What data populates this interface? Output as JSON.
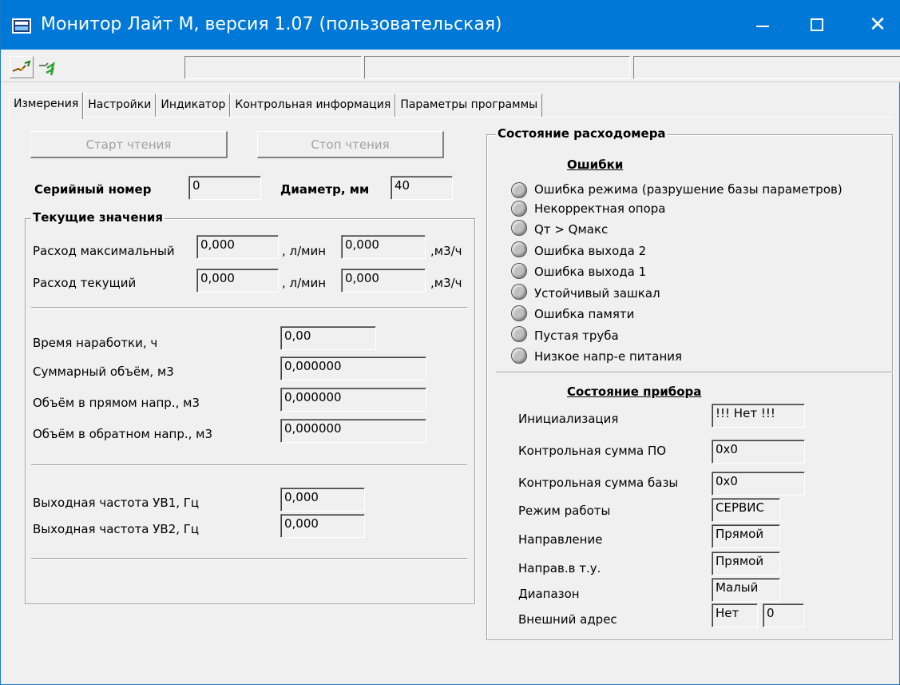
{
  "window": {
    "title": "Монитор Лайт М, версия 1.07 (пользовательская)",
    "controls": {
      "minimize": "–",
      "maximize": "□",
      "close": "✕"
    }
  },
  "toolbar": {
    "connect_icon": "connect-plug-icon",
    "refresh_icon": "green-arrows-icon",
    "status_fields": [
      "",
      "",
      "",
      ""
    ]
  },
  "tabs": [
    {
      "label": "Измерения",
      "active": true
    },
    {
      "label": "Настройки"
    },
    {
      "label": "Индикатор"
    },
    {
      "label": "Контрольная информация"
    },
    {
      "label": "Параметры программы"
    }
  ],
  "measurements": {
    "start_button": "Старт чтения",
    "stop_button": "Стоп чтения",
    "serial_label": "Серийный номер",
    "serial_value": "0",
    "diameter_label": "Диаметр, мм",
    "diameter_value": "40",
    "current_group_title": "Текущие значения",
    "flow_max_label": "Расход максимальный",
    "flow_max_lmin": "0,000",
    "flow_max_m3h": "0,000",
    "flow_cur_label": "Расход текущий",
    "flow_cur_lmin": "0,000",
    "flow_cur_m3h": "0,000",
    "unit_lmin": ", л/мин",
    "unit_m3h": ",м3/ч",
    "runtime_label": "Время наработки, ч",
    "runtime_value": "0,00",
    "total_volume_label": "Суммарный объём, м3",
    "total_volume_value": "0,000000",
    "forward_volume_label": "Объём в прямом напр., м3",
    "forward_volume_value": "0,000000",
    "reverse_volume_label": "Объём в обратном напр., м3",
    "reverse_volume_value": "0,000000",
    "freq1_label": "Выходная частота УВ1, Гц",
    "freq1_value": "0,000",
    "freq2_label": "Выходная частота УВ2, Гц",
    "freq2_value": "0,000"
  },
  "flowmeter_state": {
    "group_title": "Состояние расходомера",
    "errors_title": "Ошибки",
    "errors": [
      "Ошибка режима (разрушение базы параметров)",
      "Некорректная опора",
      "Qт > Qмакс",
      "Ошибка выхода 2",
      "Ошибка выхода 1",
      "Устойчивый зашкал",
      "Ошибка памяти",
      "Пустая труба",
      "Низкое напр-е питания"
    ],
    "device_title": "Состояние прибора",
    "init_label": "Инициализация",
    "init_value": "!!! Нет !!!",
    "sw_checksum_label": "Контрольная сумма ПО",
    "sw_checksum_value": "0x0",
    "db_checksum_label": "Контрольная сумма базы",
    "db_checksum_value": "0x0",
    "mode_label": "Режим работы",
    "mode_value": "СЕРВИС",
    "direction_label": "Направление",
    "direction_value": "Прямой",
    "tu_direction_label": "Направ.в т.у.",
    "tu_direction_value": "Прямой",
    "range_label": "Диапазон",
    "range_value": "Малый",
    "ext_addr_label": "Внешний адрес",
    "ext_addr_flag": "Нет",
    "ext_addr_value": "0"
  }
}
